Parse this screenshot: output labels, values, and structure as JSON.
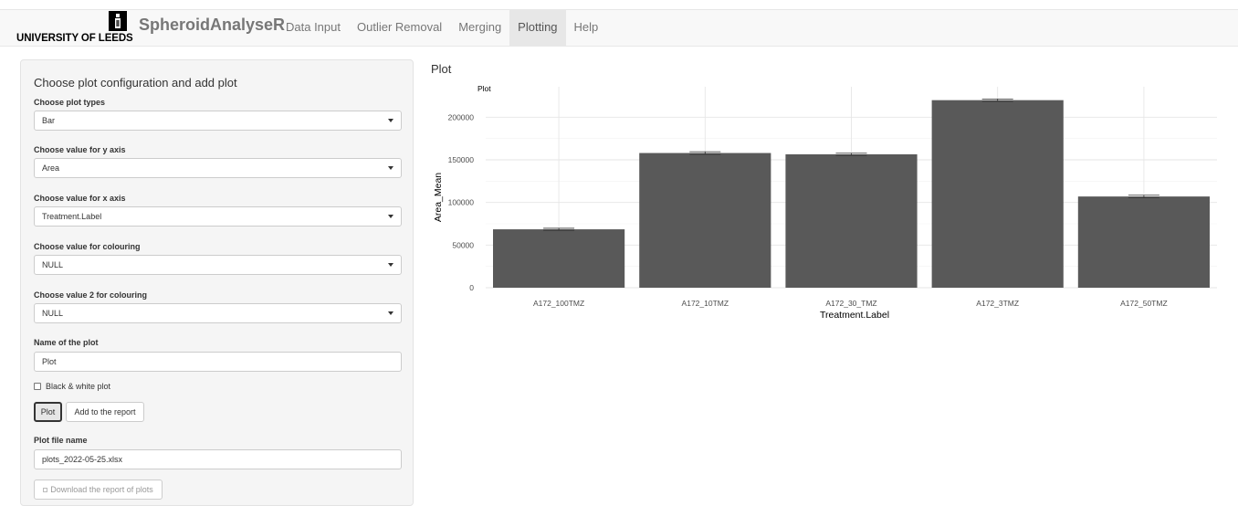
{
  "navbar": {
    "logo_text": "UNIVERSITY OF LEEDS",
    "app_title": "SpheroidAnalyseR",
    "tabs": [
      {
        "label": "Data Input",
        "active": false
      },
      {
        "label": "Outlier Removal",
        "active": false
      },
      {
        "label": "Merging",
        "active": false
      },
      {
        "label": "Plotting",
        "active": true
      },
      {
        "label": "Help",
        "active": false
      }
    ]
  },
  "sidebar": {
    "title": "Choose plot configuration and add plot",
    "plot_type_label": "Choose plot types",
    "plot_type_value": "Bar",
    "y_axis_label": "Choose value for y axis",
    "y_axis_value": "Area",
    "x_axis_label": "Choose value for x axis",
    "x_axis_value": "Treatment.Label",
    "colour_label": "Choose value for colouring",
    "colour_value": "NULL",
    "colour2_label": "Choose value 2 for colouring",
    "colour2_value": "NULL",
    "plot_name_label": "Name of the plot",
    "plot_name_value": "Plot",
    "bw_label": "Black & white plot",
    "plot_button": "Plot",
    "add_report_button": "Add to the report",
    "file_name_label": "Plot file name",
    "file_name_value": "plots_2022-05-25.xlsx",
    "download_button": "Download the report of plots"
  },
  "main": {
    "heading": "Plot"
  },
  "chart_data": {
    "type": "bar",
    "title": "Plot",
    "xlabel": "Treatment.Label",
    "ylabel": "Area_Mean",
    "categories": [
      "A172_100TMZ",
      "A172_10TMZ",
      "A172_30_TMZ",
      "A172_3TMZ",
      "A172_50TMZ"
    ],
    "values": [
      68500,
      158000,
      156500,
      220000,
      107000
    ],
    "errors": [
      1200,
      1500,
      1300,
      1400,
      1500
    ],
    "ylim": [
      0,
      225000
    ],
    "yticks": [
      0,
      50000,
      100000,
      150000,
      200000
    ],
    "ytick_labels": [
      "0",
      "50000",
      "100000",
      "150000",
      "200000"
    ],
    "bar_color": "#595959",
    "grid": true
  }
}
